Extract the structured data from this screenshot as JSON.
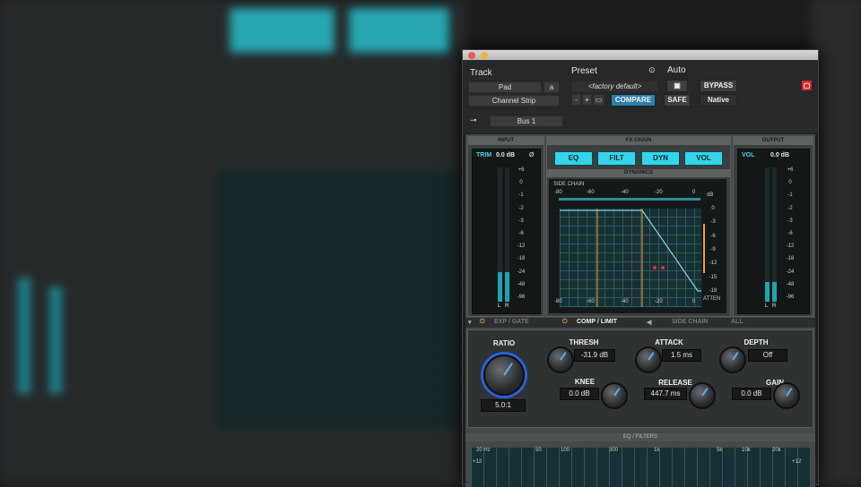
{
  "header": {
    "track_label": "Track",
    "track_name": "Pad",
    "track_channel": "a",
    "insert": "Channel Strip",
    "sidechain_input": "Bus 1",
    "preset_label": "Preset",
    "preset_name": "<factory default>",
    "compare_label": "COMPARE",
    "auto_label": "Auto",
    "bypass_label": "BYPASS",
    "safe_label": "SAFE",
    "native_label": "Native",
    "minus": "-",
    "plus": "+"
  },
  "input": {
    "title": "INPUT",
    "trim_label": "TRIM",
    "trim_value": "0.0 dB",
    "phase": "Ø",
    "scale": [
      "+6",
      "0",
      "-1",
      "-2",
      "-3",
      "-6",
      "-12",
      "-18",
      "-24",
      "-48",
      "-96"
    ],
    "lr": [
      "L",
      "R"
    ],
    "levels": [
      0.22,
      0.22
    ]
  },
  "output": {
    "title": "OUTPUT",
    "vol_label": "VOL",
    "vol_value": "0.0 dB",
    "scale": [
      "+6",
      "0",
      "-1",
      "-2",
      "-3",
      "-6",
      "-12",
      "-18",
      "-24",
      "-48",
      "-96"
    ],
    "lr": [
      "L",
      "R"
    ],
    "levels": [
      0.15,
      0.15
    ]
  },
  "fx_chain": {
    "title": "FX CHAIN",
    "buttons": [
      "EQ",
      "FILT",
      "DYN",
      "VOL"
    ]
  },
  "dynamics": {
    "title": "DYNAMICS",
    "side_chain": "SIDE CHAIN",
    "top_ticks": [
      "-80",
      "-60",
      "-40",
      "-20",
      "0"
    ],
    "bottom_ticks": [
      "-80",
      "-60",
      "-40",
      "-20",
      "0"
    ],
    "db_label": "dB",
    "right_ticks": [
      "0",
      "-3",
      "-6",
      "-9",
      "-12",
      "-15",
      "-18"
    ],
    "atten": "ATTEN"
  },
  "tabs": {
    "exp_gate": "EXP / GATE",
    "comp_limit": "COMP / LIMIT",
    "side_chain": "SIDE CHAIN",
    "all": "ALL"
  },
  "controls": {
    "ratio_label": "RATIO",
    "ratio_value": "5.0:1",
    "thresh_label": "THRESH",
    "thresh_value": "-31.9 dB",
    "knee_label": "KNEE",
    "knee_value": "0.0 dB",
    "attack_label": "ATTACK",
    "attack_value": "1.5 ms",
    "release_label": "RELEASE",
    "release_value": "447.7 ms",
    "depth_label": "DEPTH",
    "depth_value": "Off",
    "gain_label": "GAIN",
    "gain_value": "0.0 dB"
  },
  "eq_filters": {
    "title": "EQ / FILTERS",
    "freq_ticks": [
      "20 Hz",
      "50",
      "100",
      "300",
      "1k",
      "5k",
      "10k",
      "20k"
    ],
    "gain_tick": "+12"
  },
  "colors": {
    "accent": "#34d5ea",
    "meter": "#1fa3b0",
    "orange": "#e8972e",
    "red": "#e0303a"
  }
}
